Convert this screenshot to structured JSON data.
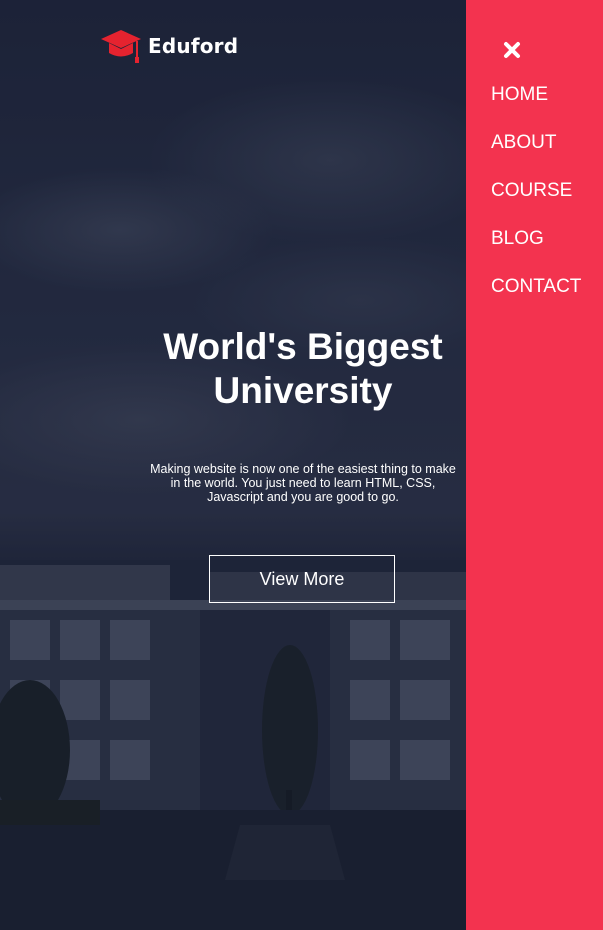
{
  "brand": {
    "name": "Eduford",
    "icon": "graduation-cap-icon",
    "icon_color": "#f44336"
  },
  "hero": {
    "title_line1": "World's Biggest",
    "title_line2": "University",
    "subtitle": "Making website is now one of the easiest thing to make in the world. You just need to learn HTML, CSS, Javascript and you are good to go.",
    "cta_label": "View More"
  },
  "nav": {
    "close_icon": "close-icon",
    "items": [
      {
        "label": "HOME"
      },
      {
        "label": "ABOUT"
      },
      {
        "label": "COURSE"
      },
      {
        "label": "BLOG"
      },
      {
        "label": "CONTACT"
      }
    ],
    "background": "#f3334f"
  }
}
